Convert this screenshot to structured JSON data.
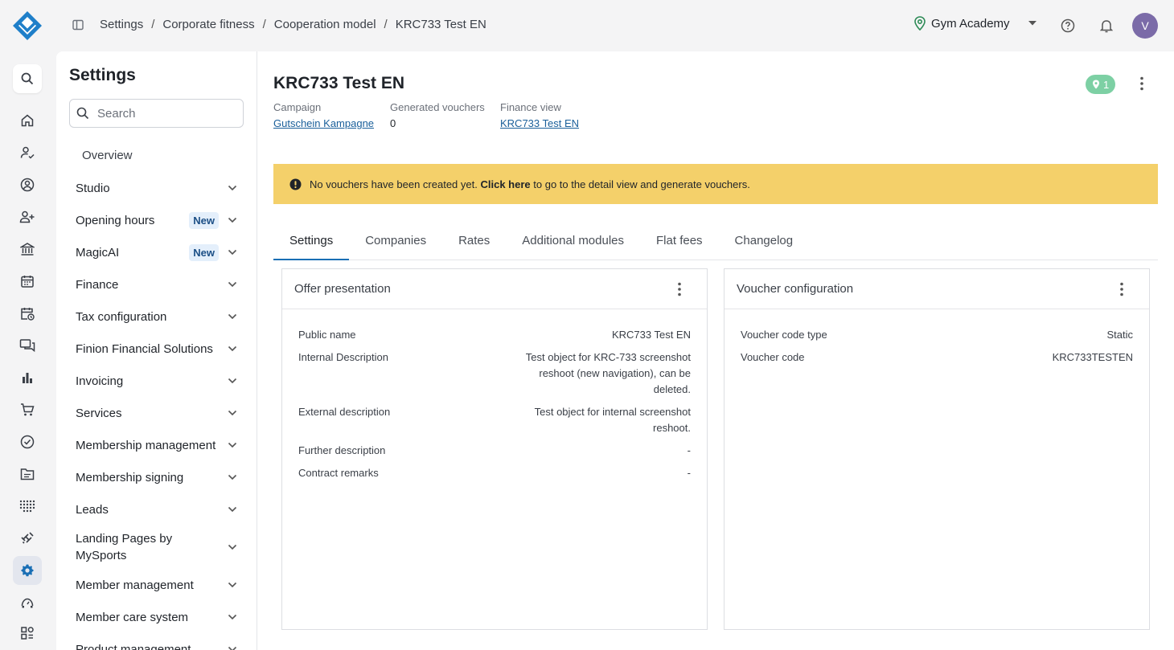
{
  "colors": {
    "accent": "#1a6fb5",
    "alert_bg": "#f4d06a",
    "pill_bg": "#7dd0a4",
    "avatar_bg": "#7b6ba8",
    "badge_bg": "#e4effb"
  },
  "breadcrumb": [
    "Settings",
    "Corporate fitness",
    "Cooperation model",
    "KRC733 Test EN"
  ],
  "header": {
    "studio": "Gym Academy",
    "avatar_initial": "V"
  },
  "rail_icons": [
    "search-icon",
    "home-icon",
    "user-check-icon",
    "profile-icon",
    "user-add-icon",
    "bank-icon",
    "calendar-icon",
    "calendar-clock-icon",
    "chat-icon",
    "bar-chart-icon",
    "cart-icon",
    "check-circle-icon",
    "folder-icon",
    "dots-grid-icon",
    "dumbbell-icon",
    "gear-icon",
    "gauge-icon",
    "apps-icon"
  ],
  "sidebar": {
    "title": "Settings",
    "search_placeholder": "Search",
    "overview": "Overview",
    "new_label": "New",
    "items": [
      {
        "label": "Studio"
      },
      {
        "label": "Opening hours"
      },
      {
        "label": "MagicAI"
      },
      {
        "label": "Finance"
      },
      {
        "label": "Tax configuration"
      },
      {
        "label": "Finion Financial Solutions"
      },
      {
        "label": "Invoicing"
      },
      {
        "label": "Services"
      },
      {
        "label": "Membership management"
      },
      {
        "label": "Membership signing"
      },
      {
        "label": "Leads"
      },
      {
        "label": "Landing Pages by MySports"
      },
      {
        "label": "Member management"
      },
      {
        "label": "Member care system"
      },
      {
        "label": "Product management"
      }
    ]
  },
  "main": {
    "title": "KRC733 Test EN",
    "pill_count": "1",
    "meta": {
      "campaign_label": "Campaign",
      "campaign_value": "Gutschein Kampagne",
      "vouchers_label": "Generated vouchers",
      "vouchers_value": "0",
      "finance_label": "Finance view",
      "finance_value": "KRC733 Test EN"
    },
    "alert": {
      "before": "No vouchers have been created yet.",
      "link": "Click here",
      "after": "to go to the detail view and generate vouchers."
    },
    "tabs": [
      "Settings",
      "Companies",
      "Rates",
      "Additional modules",
      "Flat fees",
      "Changelog"
    ],
    "offer_card": {
      "title": "Offer presentation",
      "rows": [
        {
          "k": "Public name",
          "v": "KRC733 Test EN"
        },
        {
          "k": "Internal Description",
          "v": "Test object for KRC-733 screenshot reshoot (new navigation), can be deleted."
        },
        {
          "k": "External description",
          "v": "Test object for internal screenshot reshoot."
        },
        {
          "k": "Further description",
          "v": "-"
        },
        {
          "k": "Contract remarks",
          "v": "-"
        }
      ]
    },
    "voucher_card": {
      "title": "Voucher configuration",
      "rows": [
        {
          "k": "Voucher code type",
          "v": "Static"
        },
        {
          "k": "Voucher code",
          "v": "KRC733TESTEN"
        }
      ]
    }
  }
}
